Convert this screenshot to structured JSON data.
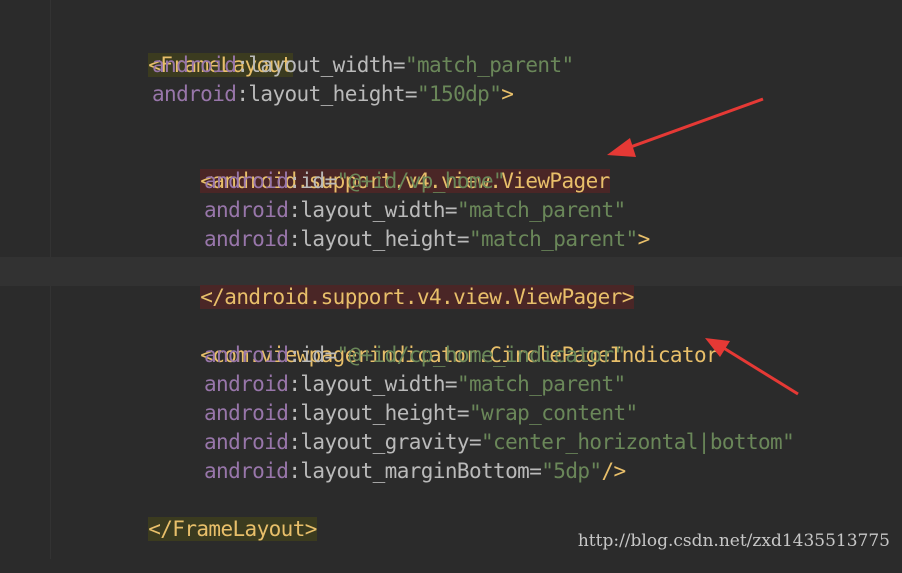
{
  "code": {
    "l1": {
      "tag": "<FrameLayout"
    },
    "l2": {
      "ns": "android",
      "sep": ":",
      "attr": "layout_width",
      "eq": "=",
      "val": "\"match_parent\""
    },
    "l3": {
      "ns": "android",
      "sep": ":",
      "attr": "layout_height",
      "eq": "=",
      "val": "\"150dp\"",
      "end": ">"
    },
    "l4": {
      "tag": "<android.support.v4.view.ViewPager"
    },
    "l5": {
      "ns": "android",
      "sep": ":",
      "attr": "id",
      "eq": "=",
      "val": "\"@+id/vp_home\""
    },
    "l6": {
      "ns": "android",
      "sep": ":",
      "attr": "layout_width",
      "eq": "=",
      "val": "\"match_parent\""
    },
    "l7": {
      "ns": "android",
      "sep": ":",
      "attr": "layout_height",
      "eq": "=",
      "val": "\"match_parent\"",
      "end": ">"
    },
    "l8": {
      "tag": "</android.support.v4.view.ViewPager>"
    },
    "l9": {
      "tag": "<com.viewpagerindicator.CirclePageIndicator"
    },
    "l10": {
      "ns": "android",
      "sep": ":",
      "attr": "id",
      "eq": "=",
      "val": "\"@+id/cp_home_indicator\""
    },
    "l11": {
      "ns": "android",
      "sep": ":",
      "attr": "layout_width",
      "eq": "=",
      "val": "\"match_parent\""
    },
    "l12": {
      "ns": "android",
      "sep": ":",
      "attr": "layout_height",
      "eq": "=",
      "val": "\"wrap_content\""
    },
    "l13": {
      "ns": "android",
      "sep": ":",
      "attr": "layout_gravity",
      "eq": "=",
      "val": "\"center_horizontal|bottom\""
    },
    "l14": {
      "ns": "android",
      "sep": ":",
      "attr": "layout_marginBottom",
      "eq": "=",
      "val": "\"5dp\"",
      "end": "/>"
    },
    "l15": {
      "tag": "</FrameLayout>"
    }
  },
  "watermark": "http://blog.csdn.net/zxd1435513775",
  "colors": {
    "background": "#2b2b2b",
    "tag": "#e8bf6a",
    "namespace": "#9876aa",
    "attribute": "#bababa",
    "value": "#6a8759",
    "arrow": "#e53935"
  }
}
